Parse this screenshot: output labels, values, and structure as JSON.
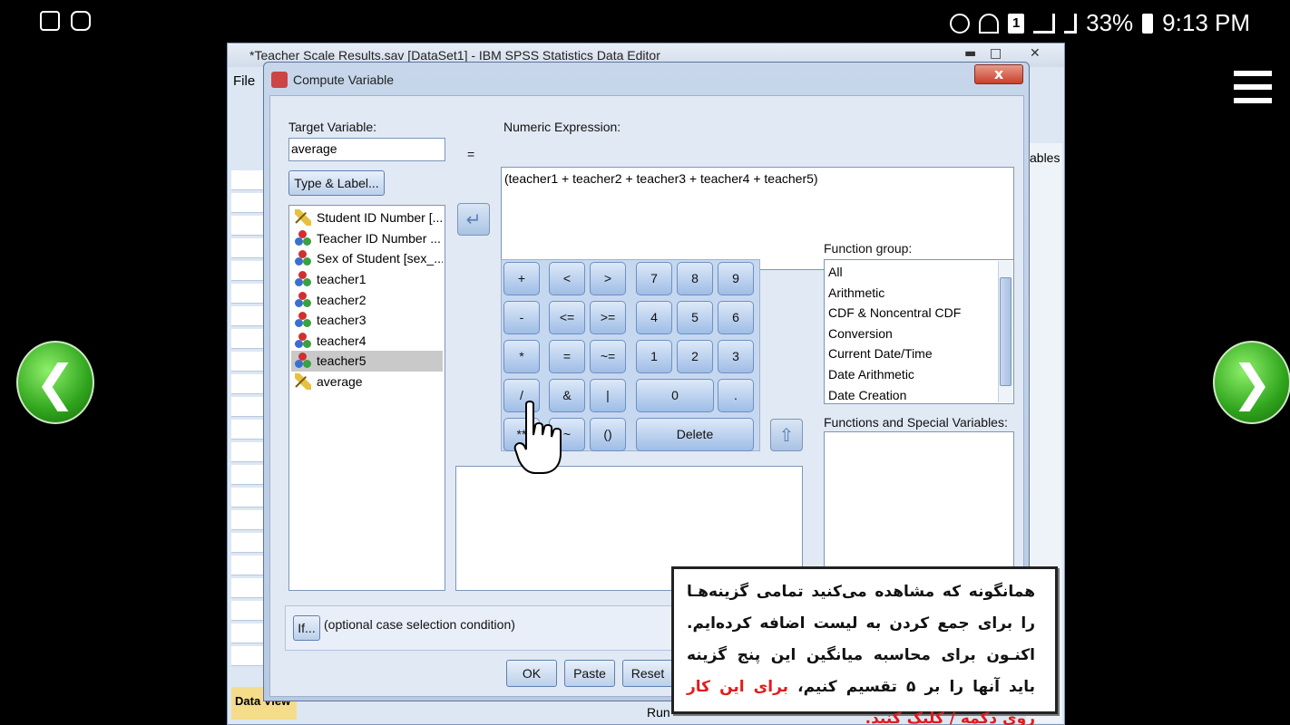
{
  "status_bar": {
    "notification_icons": [
      "gallery-icon",
      "instagram-icon"
    ],
    "sim_slot": "1",
    "battery_percent": "33%",
    "time": "9:13 PM"
  },
  "spss": {
    "title": "*Teacher Scale Results.sav [DataSet1] - IBM SPSS Statistics Data Editor",
    "menu_file": "File",
    "variables_tab_partial": "ables",
    "data_view_tab_partial": "Data View",
    "status_partial": "Run"
  },
  "dialog": {
    "title": "Compute Variable",
    "close_label": "x",
    "target_variable_label": "Target Variable:",
    "target_variable_value": "average",
    "equals": "=",
    "type_label_button": "Type & Label...",
    "numeric_expression_label": "Numeric Expression:",
    "numeric_expression_value": "(teacher1 + teacher2 + teacher3 + teacher4 + teacher5)",
    "variables": [
      {
        "label": "Student ID Number [...",
        "icon": "scale-ruler-icon"
      },
      {
        "label": "Teacher ID Number ...",
        "icon": "nominal-icon"
      },
      {
        "label": "Sex of Student [sex_...",
        "icon": "nominal-icon"
      },
      {
        "label": "teacher1",
        "icon": "nominal-icon"
      },
      {
        "label": "teacher2",
        "icon": "nominal-icon"
      },
      {
        "label": "teacher3",
        "icon": "nominal-icon"
      },
      {
        "label": "teacher4",
        "icon": "nominal-icon"
      },
      {
        "label": "teacher5",
        "icon": "nominal-icon"
      },
      {
        "label": "average",
        "icon": "scale-ruler-icon"
      }
    ],
    "selected_variable": "teacher5",
    "keypad": {
      "plus": "+",
      "lt": "<",
      "gt": ">",
      "minus": "-",
      "le": "<=",
      "ge": ">=",
      "mult": "*",
      "eq": "=",
      "ne": "~=",
      "div": "/",
      "and": "&",
      "or": "|",
      "pow": "**",
      "not": "~",
      "parens": "()",
      "n7": "7",
      "n8": "8",
      "n9": "9",
      "n4": "4",
      "n5": "5",
      "n6": "6",
      "n1": "1",
      "n2": "2",
      "n3": "3",
      "n0": "0",
      "dot": ".",
      "delete": "Delete"
    },
    "function_group_label": "Function group:",
    "function_groups": [
      "All",
      "Arithmetic",
      "CDF & Noncentral CDF",
      "Conversion",
      "Current Date/Time",
      "Date Arithmetic",
      "Date Creation"
    ],
    "functions_label": "Functions and Special Variables:",
    "if_button": "If...",
    "if_condition": "(optional case selection condition)",
    "ok_button": "OK",
    "paste_button": "Paste",
    "reset_button": "Reset"
  },
  "annotation": {
    "text_main": "همانگونه که مشاهده می‌کنید تمامی گزینه‌هـا را برای جمع کردن به لیست اضافه کرده‌ایم. اکنـون برای محاسبه میانگین این پنج گزینه باید آنها را بر ۵ تقسیم کنیم،",
    "text_highlight": "برای این کار روی دکمه / کلیک کنید."
  },
  "colors": {
    "annotation_highlight": "#e21b1b",
    "nav_arrow_green": "#2fa31c",
    "dialog_close_red": "#c9402a",
    "selection_gray": "#c9c9c9"
  }
}
